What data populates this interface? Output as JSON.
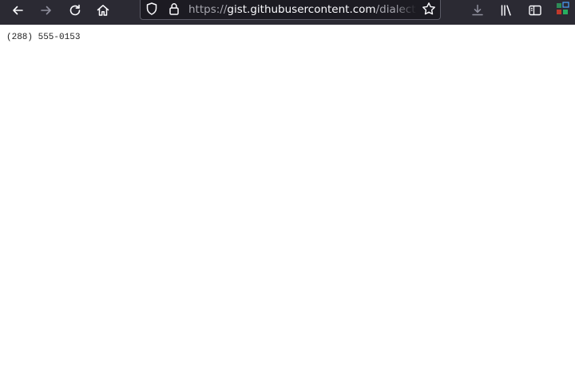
{
  "browser": {
    "url": {
      "scheme": "https://",
      "host": "gist.githubusercontent.com",
      "path": "/dialectrical/"
    },
    "toolbar_color": "#2b2a33",
    "icons": {
      "back": "back-arrow-icon",
      "forward": "forward-arrow-icon",
      "reload": "reload-icon",
      "home": "home-icon",
      "tracking_protection": "shield-icon",
      "lock": "lock-icon",
      "bookmark": "star-icon",
      "downloads": "download-icon",
      "library": "library-icon",
      "sidebar": "sidebar-icon",
      "extension": "extension-icon"
    }
  },
  "page": {
    "text": "(288) 555-0153"
  }
}
